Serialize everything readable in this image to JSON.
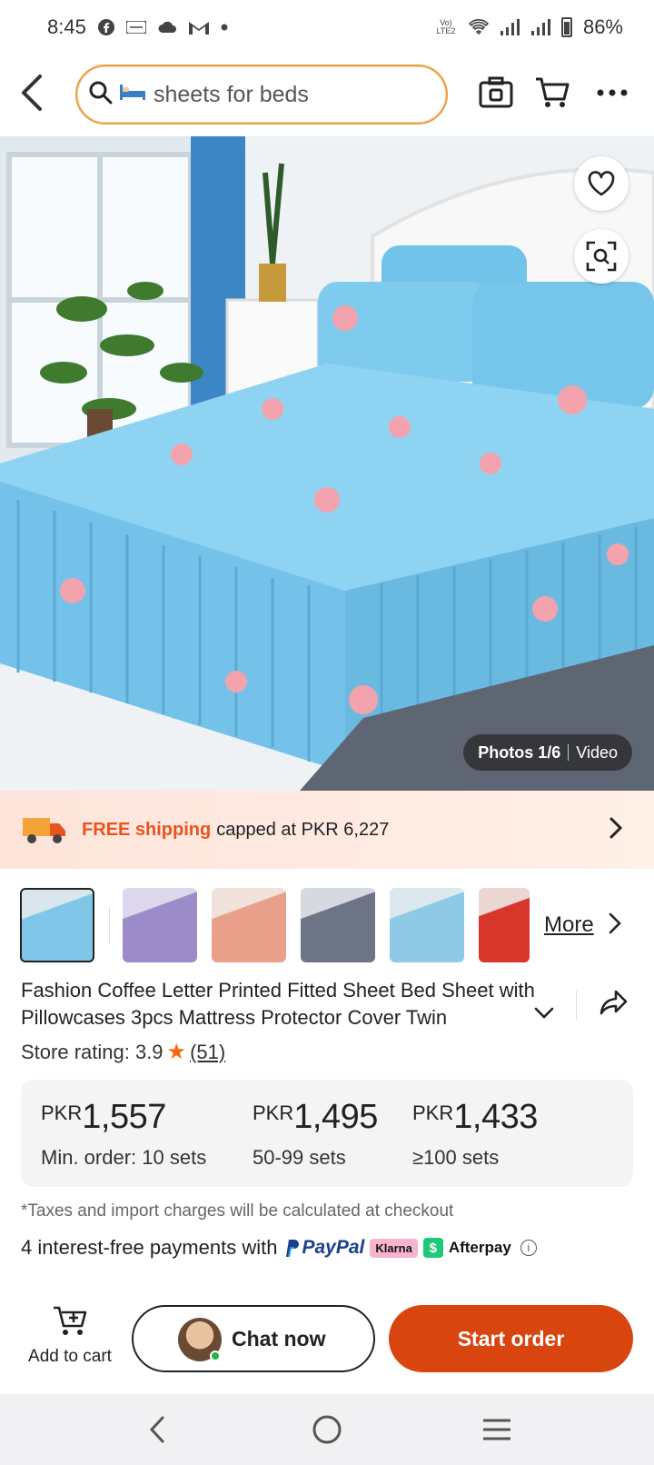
{
  "status_bar": {
    "time": "8:45",
    "network_label": "Vo) LTE2",
    "battery": "86%"
  },
  "search": {
    "query": "sheets for beds",
    "placeholder": "sheets for beds"
  },
  "hero": {
    "media_photos": "Photos 1/6",
    "media_video": "Video"
  },
  "shipping": {
    "free": "FREE shipping",
    "rest": "capped at PKR 6,227"
  },
  "thumbnails": {
    "more_label": "More",
    "items": [
      {
        "name": "blue",
        "color": "#7fc6e8"
      },
      {
        "name": "purple",
        "color": "#9b8bc8"
      },
      {
        "name": "peach",
        "color": "#e9a08b"
      },
      {
        "name": "grey",
        "color": "#6c7485"
      },
      {
        "name": "blue2",
        "color": "#8ec9e6"
      },
      {
        "name": "red",
        "color": "#d8362a"
      }
    ]
  },
  "product": {
    "title": "Fashion Coffee Letter Printed Fitted Sheet Bed Sheet with Pillowcases 3pcs Mattress Protector Cover Twin",
    "rating_label": "Store rating: 3.9",
    "rating_count": "(51)"
  },
  "pricing": {
    "tiers": [
      {
        "currency": "PKR",
        "value": "1,557",
        "qty": "Min. order: 10 sets"
      },
      {
        "currency": "PKR",
        "value": "1,495",
        "qty": "50-99 sets"
      },
      {
        "currency": "PKR",
        "value": "1,433",
        "qty": "≥100 sets"
      }
    ],
    "tax_note": "*Taxes and import charges will be calculated at checkout",
    "payments_label": "4 interest-free payments with",
    "paypal": "PayPal",
    "klarna": "Klarna",
    "afterpay": "Afterpay"
  },
  "actions": {
    "add_to_cart": "Add to cart",
    "chat": "Chat now",
    "start_order": "Start order"
  },
  "colors": {
    "accent": "#d9450f",
    "search_border": "#e8a13a",
    "free_shipping": "#e8541e"
  }
}
